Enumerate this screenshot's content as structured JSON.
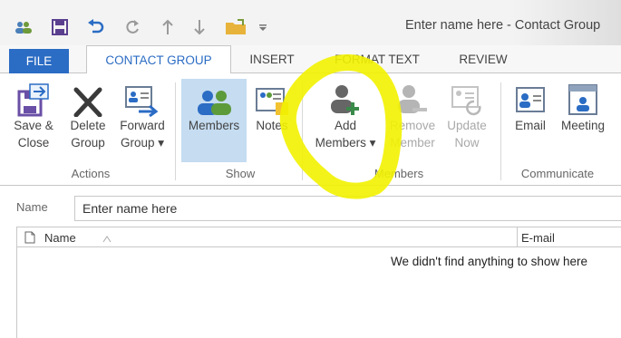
{
  "window": {
    "title": "Enter name here - Contact Group"
  },
  "quick_access": {
    "icons": [
      "contact-group-icon",
      "save-icon",
      "undo-icon",
      "redo-icon",
      "up-arrow-icon",
      "down-arrow-icon",
      "folder-icon",
      "customize-dropdown-icon"
    ]
  },
  "tabs": [
    {
      "label": "FILE"
    },
    {
      "label": "CONTACT GROUP"
    },
    {
      "label": "INSERT"
    },
    {
      "label": "FORMAT TEXT"
    },
    {
      "label": "REVIEW"
    }
  ],
  "ribbon": {
    "actions": {
      "group_label": "Actions",
      "save_close": {
        "line1": "Save &",
        "line2": "Close"
      },
      "delete_group": {
        "line1": "Delete",
        "line2": "Group"
      },
      "forward_group": {
        "line1": "Forward",
        "line2": "Group ▾"
      }
    },
    "show": {
      "group_label": "Show",
      "members": {
        "label": "Members"
      },
      "notes": {
        "label": "Notes"
      }
    },
    "members": {
      "group_label": "Members",
      "add_members": {
        "line1": "Add",
        "line2": "Members ▾"
      },
      "remove_member": {
        "line1": "Remove",
        "line2": "Member"
      },
      "update_now": {
        "line1": "Update",
        "line2": "Now"
      }
    },
    "communicate": {
      "group_label": "Communicate",
      "email": {
        "label": "Email"
      },
      "meeting": {
        "label": "Meeting"
      }
    }
  },
  "name_field": {
    "label": "Name",
    "value": "Enter name here"
  },
  "members_list": {
    "columns": [
      "Name",
      "E-mail"
    ],
    "empty_message": "We didn't find anything to show here"
  },
  "colors": {
    "accent": "#2b6cc4",
    "pressed": "#c5dcf1",
    "highlighter": "#f2f200"
  }
}
